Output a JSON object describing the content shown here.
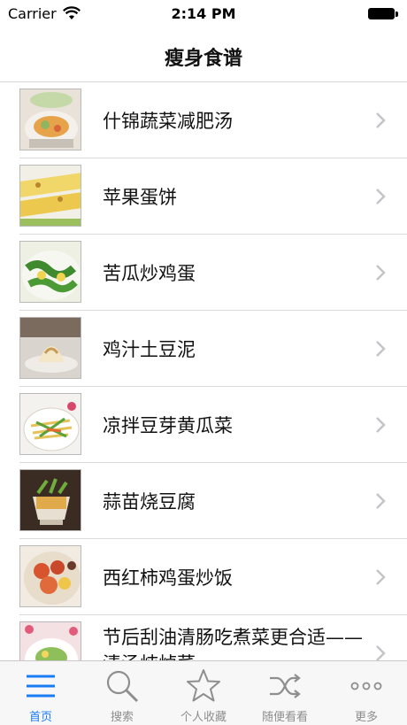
{
  "status": {
    "carrier": "Carrier",
    "time": "2:14 PM"
  },
  "nav": {
    "title": "瘦身食谱"
  },
  "recipes": [
    {
      "title": "什锦蔬菜减肥汤"
    },
    {
      "title": "苹果蛋饼"
    },
    {
      "title": "苦瓜炒鸡蛋"
    },
    {
      "title": "鸡汁土豆泥"
    },
    {
      "title": "凉拌豆芽黄瓜菜"
    },
    {
      "title": "蒜苗烧豆腐"
    },
    {
      "title": "西红柿鸡蛋炒饭"
    },
    {
      "title": "节后刮油清肠吃煮菜更合适——清汤炖焯菜"
    }
  ],
  "tabs": [
    {
      "label": "首页",
      "icon": "list-icon",
      "active": true
    },
    {
      "label": "搜索",
      "icon": "search-icon"
    },
    {
      "label": "个人收藏",
      "icon": "star-icon"
    },
    {
      "label": "随便看看",
      "icon": "shuffle-icon"
    },
    {
      "label": "更多",
      "icon": "more-icon"
    }
  ],
  "colors": {
    "accent": "#1a7cf5",
    "inactive": "#8e8e8e"
  }
}
